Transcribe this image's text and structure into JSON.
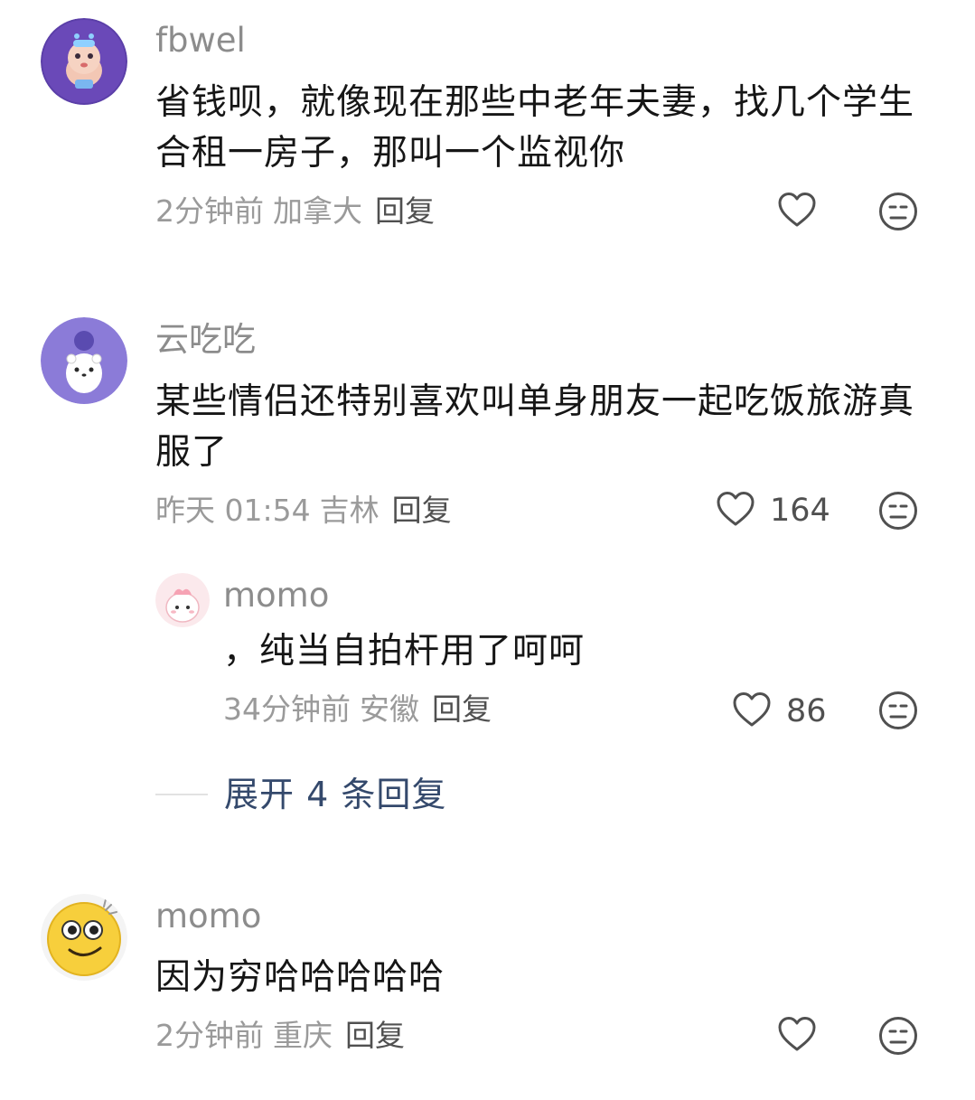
{
  "comments": [
    {
      "username": "fbwel",
      "text": "省钱呗，就像现在那些中老年夫妻，找几个学生合租一房子，那叫一个监视你",
      "time": "2分钟前",
      "location": "加拿大",
      "reply_label": "回复",
      "likes": ""
    },
    {
      "username": "云吃吃",
      "text": "某些情侣还特别喜欢叫单身朋友一起吃饭旅游真服了",
      "time": "昨天 01:54",
      "location": "吉林",
      "reply_label": "回复",
      "likes": "164",
      "replies": [
        {
          "username": "momo",
          "text": "，纯当自拍杆用了呵呵",
          "time": "34分钟前",
          "location": "安徽",
          "reply_label": "回复",
          "likes": "86"
        }
      ],
      "expand_label": "展开 4 条回复"
    },
    {
      "username": "momo",
      "text": "因为穷哈哈哈哈哈",
      "time": "2分钟前",
      "location": "重庆",
      "reply_label": "回复",
      "likes": ""
    }
  ],
  "colors": {
    "username": "#8c8c8c",
    "text": "#161616",
    "meta": "#9a9a9a",
    "expand": "#34496c"
  },
  "icons": [
    "heart-icon",
    "dislike-face-icon"
  ]
}
